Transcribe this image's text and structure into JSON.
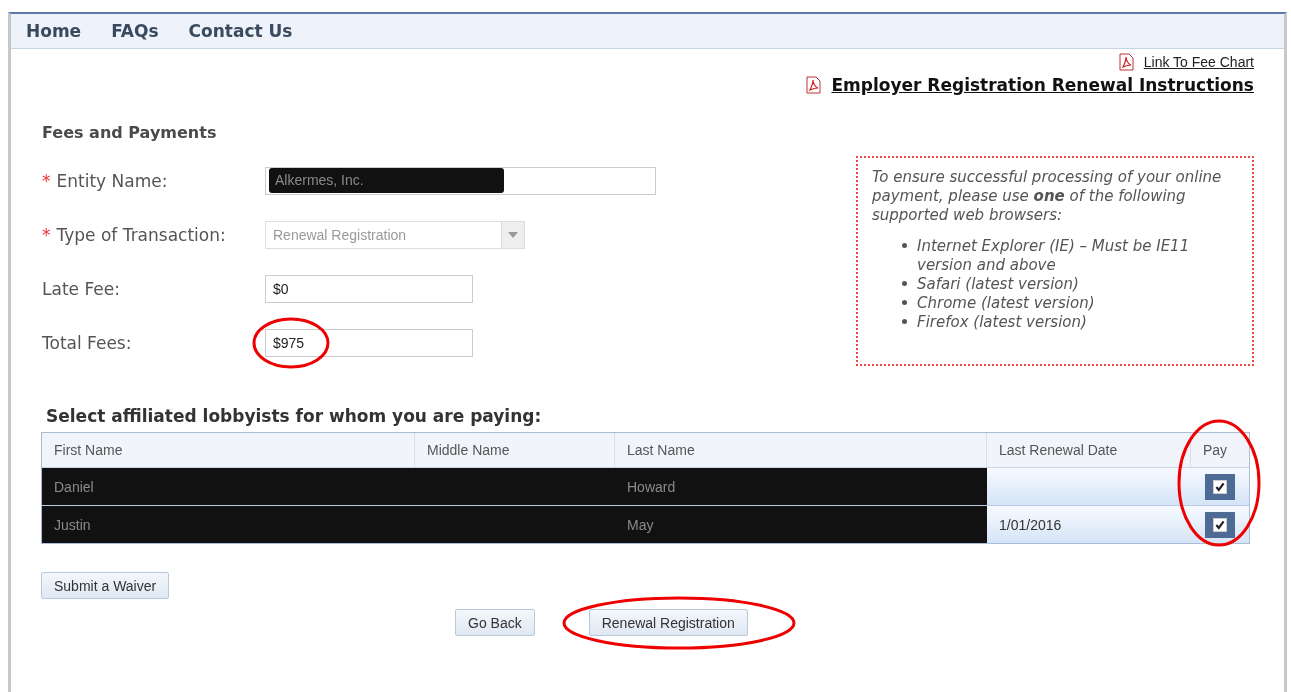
{
  "nav": [
    "Home",
    "FAQs",
    "Contact Us"
  ],
  "links": [
    {
      "text": "Link To Fee Chart",
      "kind": "small"
    },
    {
      "text": "Employer Registration Renewal Instructions",
      "kind": "large"
    }
  ],
  "section_title": "Fees and Payments",
  "fields": [
    {
      "label": "Entity Name:",
      "required_mark": "*",
      "kind": "text",
      "value": "Alkermes, Inc.",
      "redacted": true
    },
    {
      "label": "Type of Transaction:",
      "required_mark": "*",
      "kind": "select",
      "value": "Renewal Registration",
      "disabled": true
    },
    {
      "label": "Late Fee:",
      "kind": "text",
      "value": "$0",
      "redacted": false
    },
    {
      "label": "Total Fees:",
      "kind": "text",
      "value": "$975",
      "redacted": false,
      "circled": true
    }
  ],
  "notice": {
    "text": "To ensure successful processing of your online payment, please use **one** of the following supported web browsers:",
    "items": [
      "Internet Explorer (IE) – Must be IE11 version and above",
      "Safari (latest version)",
      "Chrome (latest version)",
      "Firefox (latest version)"
    ]
  },
  "table": {
    "title": "Select affiliated lobbyists for whom you are paying:",
    "columns": [
      "First Name",
      "Middle Name",
      "Last Name",
      "Last Renewal Date",
      "Pay"
    ],
    "pay_circled": true,
    "rows": [
      {
        "first_name": "Daniel",
        "last_name": "Howard",
        "pay": true,
        "redacted": true
      },
      {
        "first_name": "Justin",
        "last_name": "May",
        "last_renewal_date": "1/01/2016",
        "pay": true,
        "redacted": true
      }
    ]
  },
  "buttons": [
    {
      "label": "Submit a Waiver"
    },
    {
      "label": "Go Back"
    },
    {
      "label": "Renewal Registration",
      "circled": true
    }
  ]
}
